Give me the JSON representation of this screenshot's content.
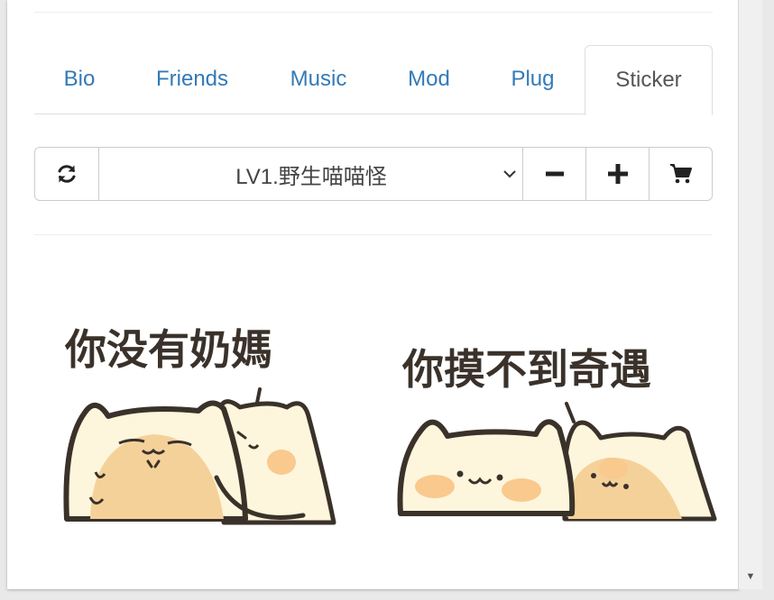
{
  "tabs": [
    {
      "label": "Bio"
    },
    {
      "label": "Friends"
    },
    {
      "label": "Music"
    },
    {
      "label": "Mod"
    },
    {
      "label": "Plug"
    },
    {
      "label": "Sticker",
      "active": true
    }
  ],
  "toolbar": {
    "refresh_icon": "refresh-icon",
    "selected_pack": "LV1.野生喵喵怪",
    "dropdown_icon": "chevron-down-icon",
    "minus_icon": "minus-icon",
    "plus_icon": "plus-icon",
    "cart_icon": "cart-icon"
  },
  "stickers": [
    {
      "caption": "你没有奶媽"
    },
    {
      "caption": "你摸不到奇遇"
    }
  ],
  "colors": {
    "link": "#337ab7",
    "cat_body": "#fdf6dc",
    "cat_patch": "#f5d19a",
    "cat_blush": "#f9c98e",
    "outline": "#3a322a"
  }
}
